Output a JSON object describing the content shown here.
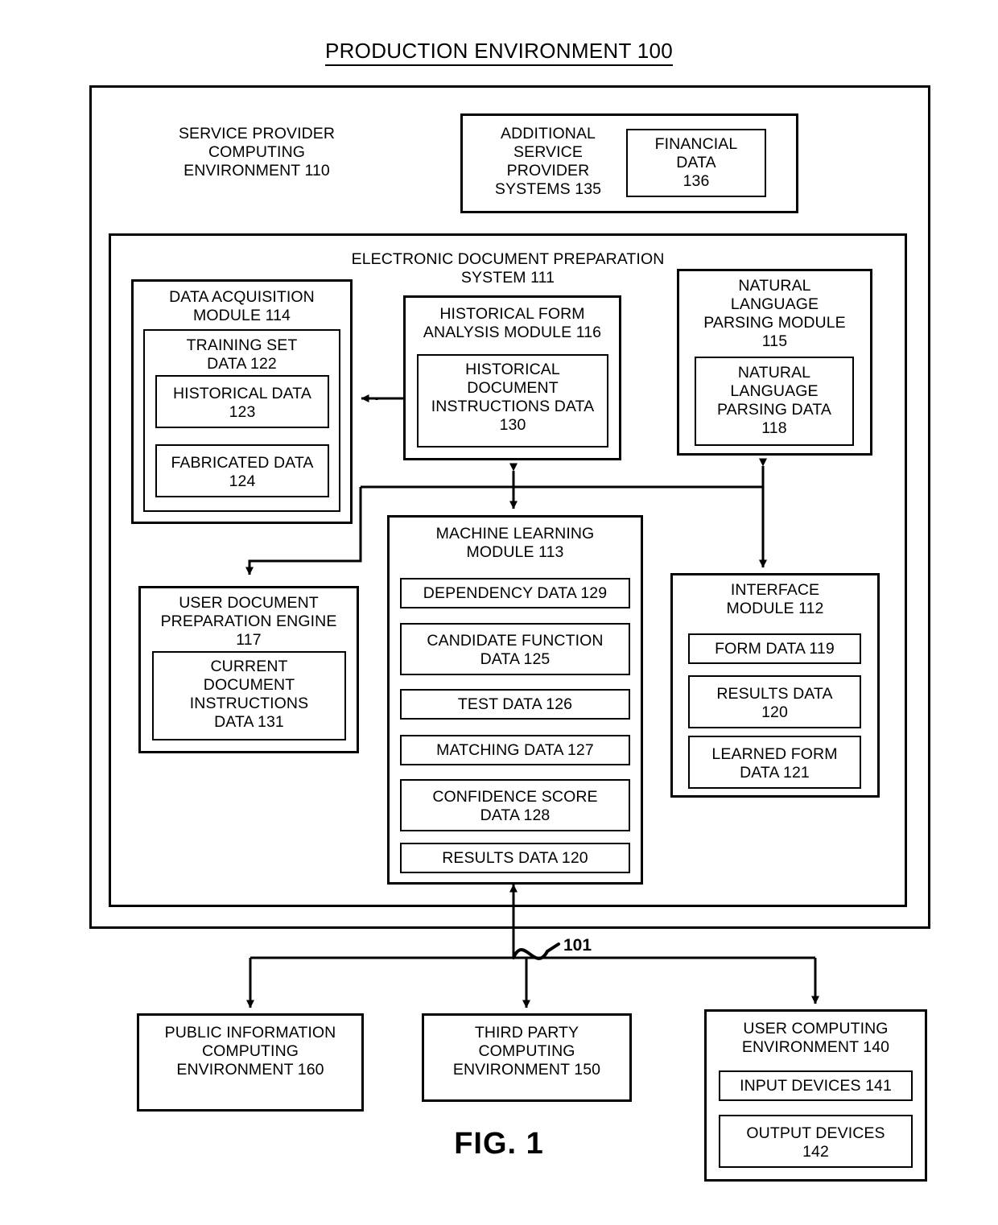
{
  "figure": {
    "title": "PRODUCTION ENVIRONMENT 100",
    "caption": "FIG. 1",
    "network_label": "101"
  },
  "service_provider": {
    "label": "SERVICE PROVIDER\nCOMPUTING\nENVIRONMENT 110"
  },
  "additional_service_provider": {
    "label": "ADDITIONAL\nSERVICE\nPROVIDER\nSYSTEMS 135",
    "financial_data": "FINANCIAL\nDATA\n136"
  },
  "edps": {
    "label": "ELECTRONIC DOCUMENT PREPARATION\nSYSTEM  111"
  },
  "data_acquisition": {
    "label": "DATA ACQUISITION\nMODULE 114",
    "training_set": "TRAINING SET\nDATA 122",
    "historical_data": "HISTORICAL DATA\n123",
    "fabricated_data": "FABRICATED DATA\n124"
  },
  "historical_form_analysis": {
    "label": "HISTORICAL FORM\nANALYSIS MODULE 116",
    "historical_document_instructions": "HISTORICAL\nDOCUMENT\nINSTRUCTIONS DATA\n130"
  },
  "natural_language_parsing": {
    "label": "NATURAL\nLANGUAGE\nPARSING MODULE\n115",
    "parsing_data": "NATURAL\nLANGUAGE\nPARSING DATA\n118"
  },
  "machine_learning": {
    "label": "MACHINE LEARNING\nMODULE 113",
    "items": [
      "DEPENDENCY DATA 129",
      "CANDIDATE FUNCTION\nDATA 125",
      "TEST DATA 126",
      "MATCHING DATA 127",
      "CONFIDENCE SCORE\nDATA 128",
      "RESULTS DATA 120"
    ]
  },
  "interface_module": {
    "label": "INTERFACE\nMODULE 112",
    "items": [
      "FORM DATA 119",
      "RESULTS DATA\n120",
      "LEARNED FORM\nDATA 121"
    ]
  },
  "user_document_preparation": {
    "label": "USER DOCUMENT\nPREPARATION  ENGINE\n117",
    "current_document_instructions": "CURRENT\nDOCUMENT\nINSTRUCTIONS\nDATA 131"
  },
  "public_information": {
    "label": "PUBLIC INFORMATION\nCOMPUTING\nENVIRONMENT 160"
  },
  "third_party": {
    "label": "THIRD PARTY\nCOMPUTING\nENVIRONMENT 150"
  },
  "user_computing": {
    "label": "USER COMPUTING\nENVIRONMENT 140",
    "input_devices": "INPUT DEVICES 141",
    "output_devices": "OUTPUT DEVICES\n142"
  }
}
